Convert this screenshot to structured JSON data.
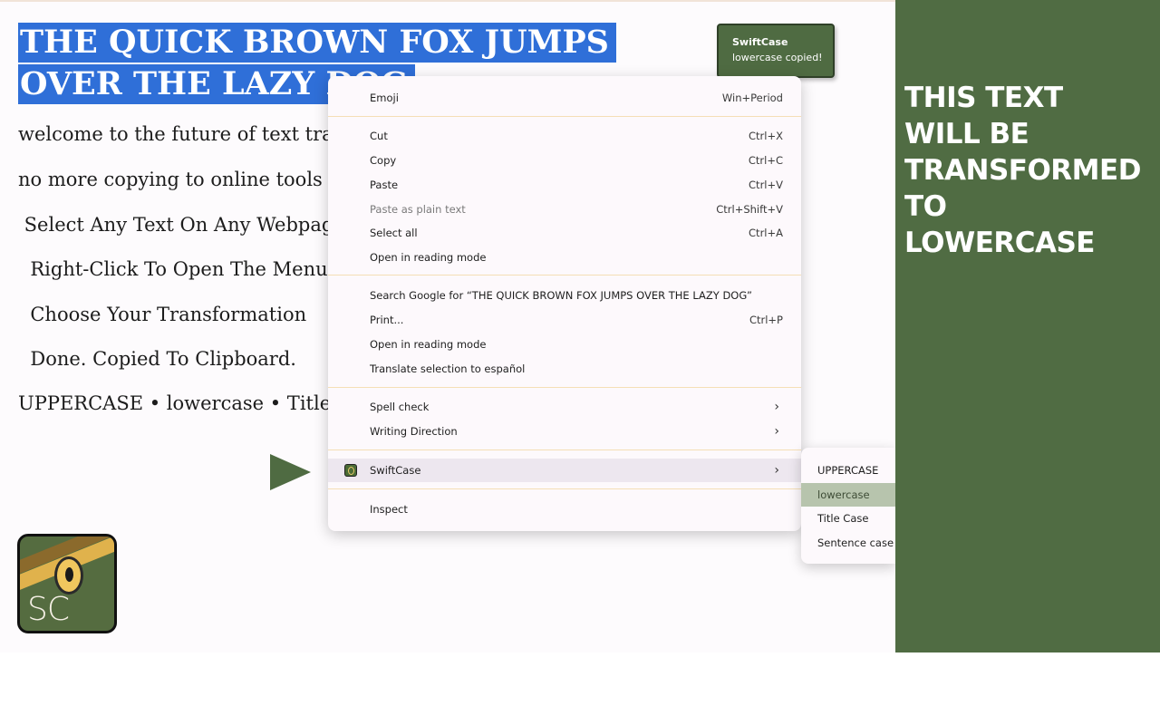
{
  "headline": {
    "line1": "THE QUICK BROWN FOX JUMPS",
    "line2": "OVER THE LAZY DOG"
  },
  "body_lines": [
    "welcome to the future of text transf",
    "no more copying to online tools or",
    " Select Any Text On Any Webpage",
    "  Right-Click To Open The Menu",
    "  Choose Your Transformation",
    "  Done. Copied To Clipboard.",
    "UPPERCASE • lowercase • Title Cas"
  ],
  "toast": {
    "title": "SwiftCase",
    "message": "lowercase copied!"
  },
  "context_menu": {
    "items": [
      {
        "label": "Emoji",
        "shortcut": "Win+Period"
      },
      {
        "label": "Cut",
        "shortcut": "Ctrl+X"
      },
      {
        "label": "Copy",
        "shortcut": "Ctrl+C"
      },
      {
        "label": "Paste",
        "shortcut": "Ctrl+V"
      },
      {
        "label": "Paste as plain text",
        "shortcut": "Ctrl+Shift+V"
      },
      {
        "label": "Select all",
        "shortcut": "Ctrl+A"
      },
      {
        "label": "Open in reading mode",
        "shortcut": ""
      },
      {
        "label": "Search Google for “THE QUICK BROWN FOX JUMPS OVER THE LAZY DOG”",
        "shortcut": ""
      },
      {
        "label": "Print...",
        "shortcut": "Ctrl+P"
      },
      {
        "label": "Open in reading mode",
        "shortcut": ""
      },
      {
        "label": "Translate selection to español",
        "shortcut": ""
      },
      {
        "label": "Spell check",
        "shortcut": ""
      },
      {
        "label": "Writing Direction",
        "shortcut": ""
      },
      {
        "label": "SwiftCase",
        "shortcut": ""
      },
      {
        "label": "Inspect",
        "shortcut": ""
      }
    ]
  },
  "submenu": {
    "items": [
      "UPPERCASE",
      "lowercase",
      "Title Case",
      "Sentence case"
    ],
    "selected": "lowercase"
  },
  "logo_text": "SC",
  "promo": {
    "text": "THIS TEXT\nWILL BE\nTRANSFORMED\nTO\nLOWERCASE"
  },
  "colors": {
    "brand_green": "#506c43",
    "selection_blue": "#2f6fd8",
    "submenu_highlight": "#b7c4ad"
  }
}
